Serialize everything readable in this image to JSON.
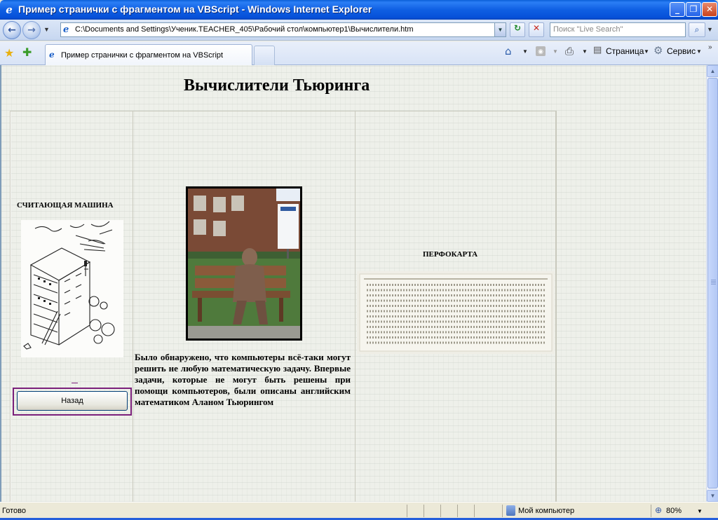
{
  "window": {
    "title": "Пример странички с фрагментом на VBScript - Windows Internet Explorer",
    "minimize_glyph": "_",
    "restore_glyph": "❐",
    "close_glyph": "✕"
  },
  "address_bar": {
    "url": "C:\\Documents and Settings\\Ученик.TEACHER_405\\Рабочий стол\\компьютер1\\Вычислители.htm",
    "back_glyph": "←",
    "forward_glyph": "→",
    "refresh_glyph": "↻",
    "stop_glyph": "✕",
    "search_placeholder": "Поиск \"Live Search\"",
    "search_glyph": "⌕"
  },
  "tabs": [
    {
      "label": "Пример странички с фрагментом на VBScript",
      "active": true
    }
  ],
  "command_bar": {
    "home_glyph": "⌂",
    "feeds_glyph": "◉",
    "print_glyph": "⎙",
    "page_label": "Страница",
    "tools_label": "Сервис",
    "more_glyph": "»"
  },
  "page": {
    "heading": "Вычислители Тьюринга",
    "caption_machine": "СЧИТАЮЩАЯ МАШИНА",
    "caption_card": "ПЕРФОКАРТА",
    "body_text": "Было обнаружено, что компьютеры всё-таки могут решить не любую математическую задачу. Впервые задачи, которые не могут быть решены при помощи компьютеров, были описаны английским математиком Аланом Тьюрингом",
    "back_button": "Назад"
  },
  "status_bar": {
    "status": "Готово",
    "zone": "Мой компьютер",
    "zoom": "80%"
  },
  "icons": {
    "ie_logo": "ie-logo-icon",
    "favorites": "favorites-star-icon",
    "add_favorites": "add-favorites-icon",
    "home": "home-icon",
    "feeds": "rss-feeds-icon",
    "print": "printer-icon",
    "page": "page-icon",
    "tools": "gear-icon",
    "zone": "computer-zone-icon",
    "zoom": "zoom-icon"
  },
  "colors": {
    "titlebar": "#0a5fd8",
    "back_button_frame": "#7a1f7a",
    "page_background": "#eef0ea"
  }
}
